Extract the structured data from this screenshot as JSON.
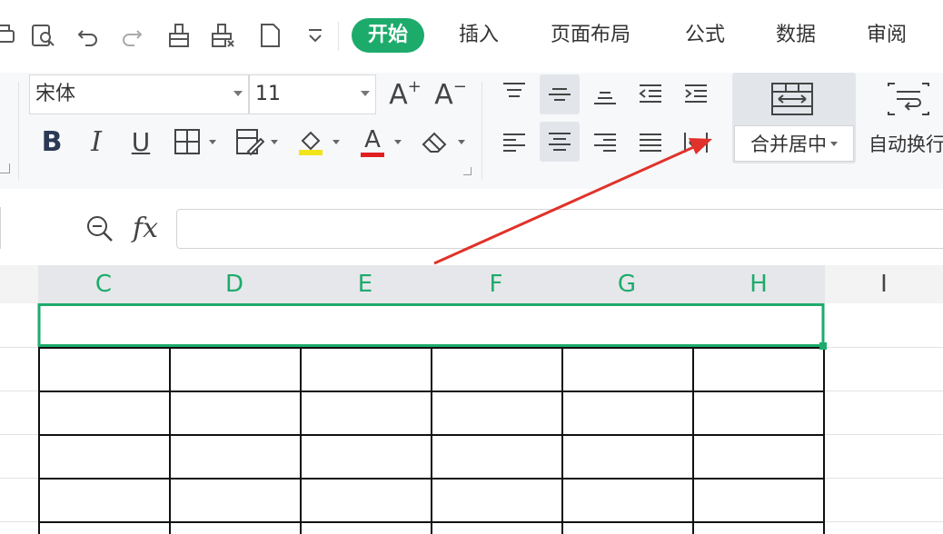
{
  "tabs": [
    {
      "label": "开始",
      "active": true
    },
    {
      "label": "插入",
      "active": false
    },
    {
      "label": "页面布局",
      "active": false
    },
    {
      "label": "公式",
      "active": false
    },
    {
      "label": "数据",
      "active": false
    },
    {
      "label": "审阅",
      "active": false
    }
  ],
  "font": {
    "name": "宋体",
    "size": "11"
  },
  "format_buttons": {
    "bold": "B",
    "italic": "I",
    "underline": "U",
    "font_color_letter": "A"
  },
  "font_size_buttons": {
    "increase": "A",
    "decrease": "A"
  },
  "merge_button": {
    "label": "合并居中"
  },
  "wrap_button": {
    "label": "自动换行"
  },
  "formula_bar": {
    "fx_label": "fx",
    "value": ""
  },
  "columns": [
    "C",
    "D",
    "E",
    "F",
    "G",
    "H",
    "I"
  ],
  "colors": {
    "accent": "#1dab6c",
    "highlight_yellow": "#f2e41a",
    "font_red": "#e02020",
    "arrow_red": "#e0322a",
    "grid_border": "#111111"
  }
}
